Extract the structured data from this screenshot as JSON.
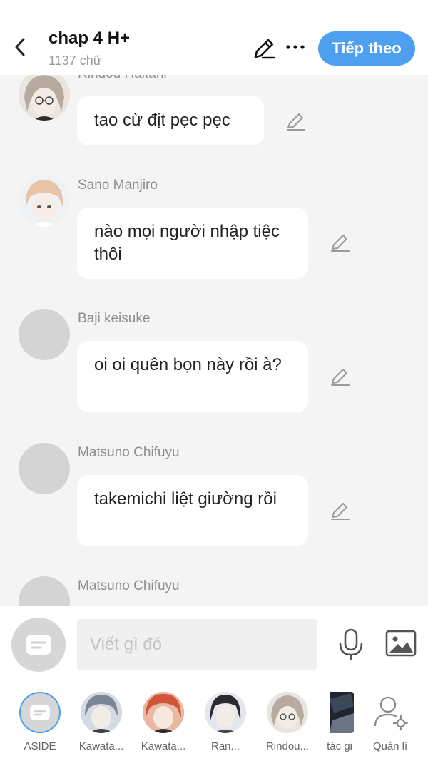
{
  "header": {
    "title": "chap 4 H+",
    "word_count": "1137 chữ",
    "next_label": "Tiếp theo"
  },
  "messages": [
    {
      "sender": "Rindou Haitani",
      "text": "tao cừ địt pẹc pẹc",
      "avatar": "anime-portrait"
    },
    {
      "sender": "Sano Manjiro",
      "text": "nào mọi người nhập tiệc thôi",
      "avatar": "anime-portrait"
    },
    {
      "sender": "Baji keisuke",
      "text": "oi oi quên bọn này rồi à?",
      "avatar": "placeholder"
    },
    {
      "sender": "Matsuno Chifuyu",
      "text": "takemichi liệt giường rồi",
      "avatar": "placeholder"
    },
    {
      "sender": "Matsuno Chifuyu",
      "text": "",
      "avatar": "placeholder"
    }
  ],
  "composer": {
    "placeholder": "Viết gì đó"
  },
  "characters": [
    {
      "label": "ASIDE"
    },
    {
      "label": "Kawata..."
    },
    {
      "label": "Kawata..."
    },
    {
      "label": "Ran..."
    },
    {
      "label": "Rindou..."
    },
    {
      "label": "tác gi"
    },
    {
      "label": "Quản lí"
    }
  ],
  "colors": {
    "accent": "#4f9ff0",
    "background": "#f4f4f4",
    "placeholder_avatar": "#d4d4d4"
  }
}
